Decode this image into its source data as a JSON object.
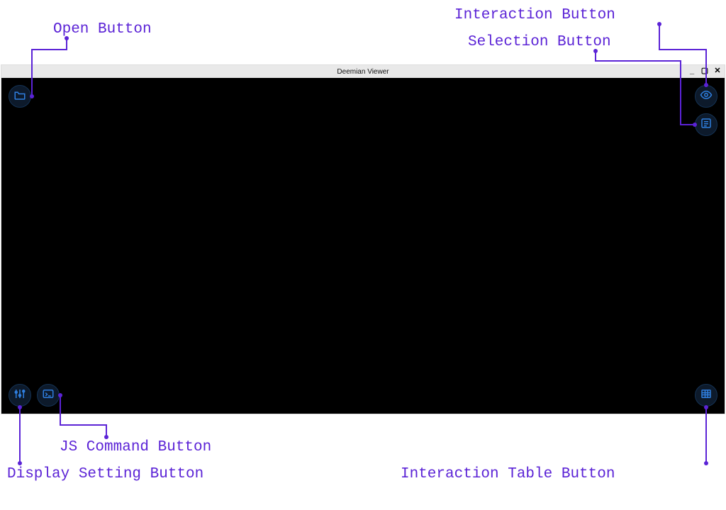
{
  "window": {
    "title": "Deemian Viewer"
  },
  "labels": {
    "open": "Open Button",
    "interaction": "Interaction Button",
    "selection": "Selection Button",
    "js_command": "JS Command Button",
    "display_setting": "Display Setting Button",
    "interaction_table": "Interaction Table Button"
  },
  "icons": {
    "open": "folder-icon",
    "interaction": "eye-icon",
    "selection": "list-icon",
    "display_setting": "sliders-icon",
    "js_command": "terminal-icon",
    "interaction_table": "table-icon"
  },
  "colors": {
    "label": "#5b23d6",
    "button_bg": "#0d1a2b",
    "button_border": "#143254",
    "icon_stroke": "#2f7fe0",
    "viewport_bg": "#000000"
  }
}
